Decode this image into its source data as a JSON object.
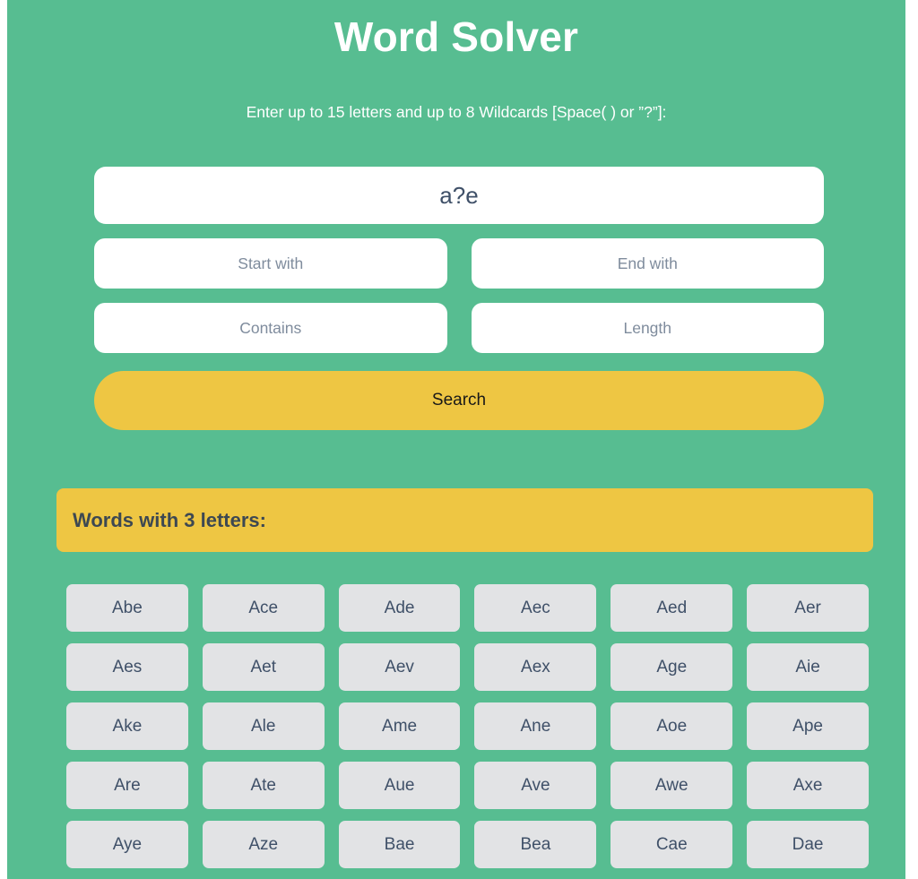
{
  "header": {
    "title": "Word Solver",
    "subtitle": "Enter up to 15 letters and up to 8 Wildcards [Space( ) or ”?”]:"
  },
  "form": {
    "main_input": {
      "value": "a?e",
      "placeholder": "Enter up to 15 letters and up to 8 Wildcards"
    },
    "start_with": {
      "value": "",
      "placeholder": "Start with"
    },
    "end_with": {
      "value": "",
      "placeholder": "End with"
    },
    "contains": {
      "value": "",
      "placeholder": "Contains"
    },
    "length": {
      "value": "",
      "placeholder": "Length"
    },
    "search_button": "Search"
  },
  "results": {
    "heading": "Words with 3 letters:",
    "words": [
      "Abe",
      "Ace",
      "Ade",
      "Aec",
      "Aed",
      "Aer",
      "Aes",
      "Aet",
      "Aev",
      "Aex",
      "Age",
      "Aie",
      "Ake",
      "Ale",
      "Ame",
      "Ane",
      "Aoe",
      "Ape",
      "Are",
      "Ate",
      "Aue",
      "Ave",
      "Awe",
      "Axe",
      "Aye",
      "Aze",
      "Bae",
      "Bea",
      "Cae",
      "Dae"
    ]
  },
  "colors": {
    "background_green": "#57bd91",
    "accent_yellow": "#eec643",
    "tile_gray": "#e2e3e5",
    "text_dark": "#3f5068",
    "placeholder_gray": "#7f8c9d",
    "heading_dark": "#3d4852",
    "white": "#ffffff"
  }
}
